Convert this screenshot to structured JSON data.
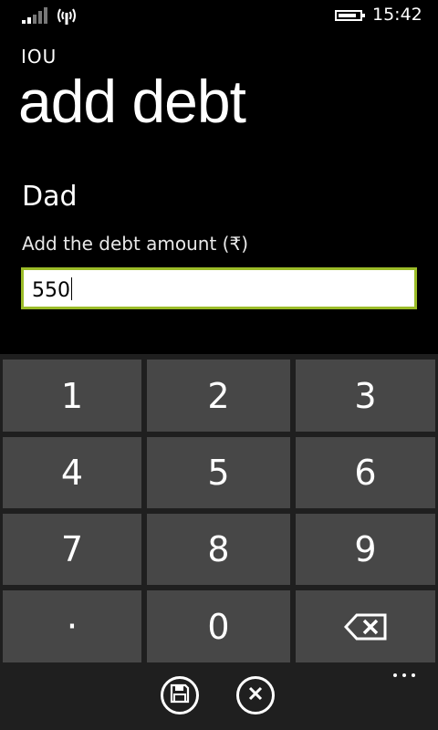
{
  "status_bar": {
    "time": "15:42",
    "battery_level": 0.85,
    "signal_icon": "signal-bars-icon",
    "wifi_icon": "wifi-icon"
  },
  "header": {
    "app_title": "IOU",
    "page_title": "add debt"
  },
  "form": {
    "person_name": "Dad",
    "amount_label": "Add the debt amount (₹)",
    "amount_value": "550",
    "accent_color": "#9bbc28"
  },
  "keypad": {
    "keys": [
      "1",
      "2",
      "3",
      "4",
      "5",
      "6",
      "7",
      "8",
      "9",
      "·",
      "0"
    ],
    "backspace_icon": "backspace-icon"
  },
  "app_bar": {
    "buttons": [
      "save-icon",
      "cancel-icon"
    ],
    "more_icon": "more-dots-icon"
  }
}
